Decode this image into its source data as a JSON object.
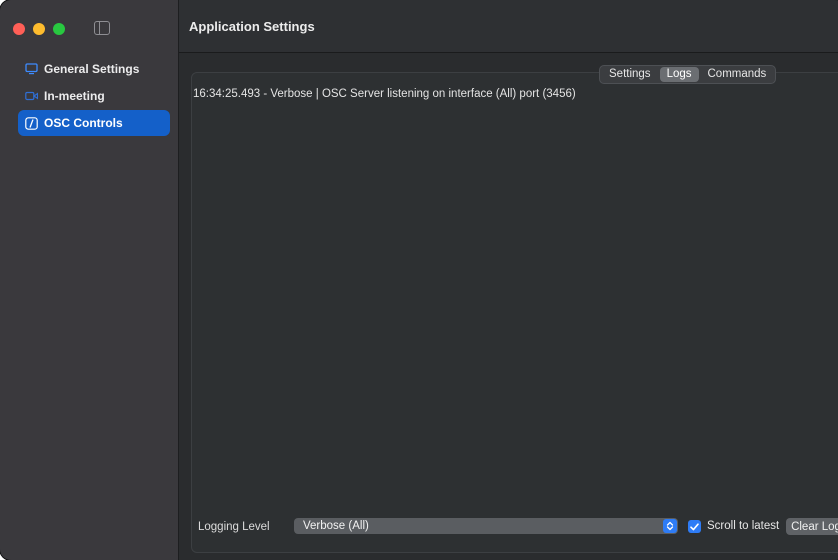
{
  "window": {
    "title": "Application Settings"
  },
  "sidebar": {
    "items": [
      {
        "label": "General Settings",
        "icon": "monitor-icon"
      },
      {
        "label": "In-meeting",
        "icon": "video-camera-icon"
      },
      {
        "label": "OSC Controls",
        "icon": "slash-square-icon",
        "active": true
      }
    ]
  },
  "tabs": [
    {
      "label": "Settings"
    },
    {
      "label": "Logs",
      "selected": true
    },
    {
      "label": "Commands"
    }
  ],
  "log": {
    "lines": [
      "16:34:25.493 - Verbose | OSC Server listening on interface (All) port (3456)"
    ]
  },
  "footer": {
    "logging_label": "Logging Level",
    "logging_value": "Verbose (All)",
    "scroll_label": "Scroll to latest",
    "scroll_checked": true,
    "clear_label": "Clear Log"
  },
  "colors": {
    "accent": "#1460c9",
    "checkbox": "#2e7cf6"
  }
}
